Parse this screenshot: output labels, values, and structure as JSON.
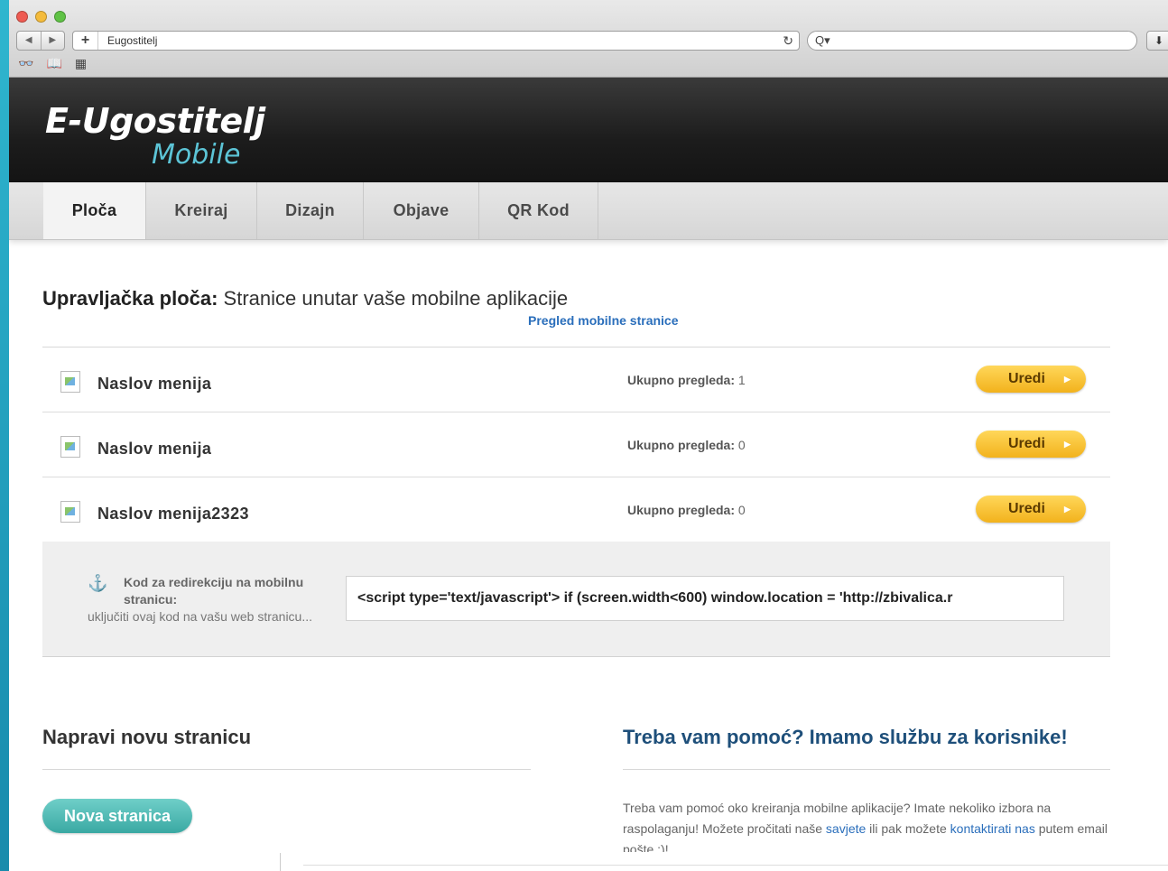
{
  "browser": {
    "tab_title": "Eugostitelj",
    "search_placeholder": "",
    "nav_back": "◀",
    "nav_forward": "▶",
    "new_tab": "+",
    "reload": "↻",
    "search_icon": "Q▾",
    "download_icon": "⬇",
    "bookmark_icons": [
      "glasses-icon",
      "book-icon",
      "grid-icon"
    ],
    "bookmark_glyphs": [
      "👓",
      "📖",
      "▦"
    ]
  },
  "header": {
    "logo_main": "E-Ugostitelj",
    "logo_sub": "Mobile"
  },
  "tabs": [
    {
      "label": "Ploča",
      "active": true
    },
    {
      "label": "Kreiraj",
      "active": false
    },
    {
      "label": "Dizajn",
      "active": false
    },
    {
      "label": "Objave",
      "active": false
    },
    {
      "label": "QR Kod",
      "active": false
    }
  ],
  "dashboard": {
    "title_bold": "Upravljačka ploča:",
    "title_rest": " Stranice unutar vaše mobilne aplikacije",
    "preview_link": "Pregled mobilne stranice",
    "rows": [
      {
        "title": "Naslov menija",
        "views_label": "Ukupno pregleda:",
        "views": "1",
        "button": "Uredi"
      },
      {
        "title": "Naslov menija",
        "views_label": "Ukupno pregleda:",
        "views": "0",
        "button": "Uredi"
      },
      {
        "title": "Naslov menija2323",
        "views_label": "Ukupno pregleda:",
        "views": "0",
        "button": "Uredi"
      }
    ]
  },
  "redirect": {
    "title": "Kod za redirekciju na mobilnu stranicu:",
    "subtitle": "uključiti ovaj kod na vašu web stranicu...",
    "code": "<script type='text/javascript'> if (screen.width<600) window.location = 'http://zbivalica.r"
  },
  "new_page": {
    "title": "Napravi novu stranicu",
    "button": "Nova stranica"
  },
  "help": {
    "title": "Treba vam pomoć? Imamo službu za korisnike!",
    "text_1": "Treba vam pomoć oko kreiranja mobilne aplikacije? Imate nekoliko izbora na raspolaganju! Možete pročitati naše ",
    "link_1": "savjete",
    "text_2": " ili pak možete ",
    "link_2": "kontaktirati nas",
    "text_3": " putem email pošte :)!"
  }
}
